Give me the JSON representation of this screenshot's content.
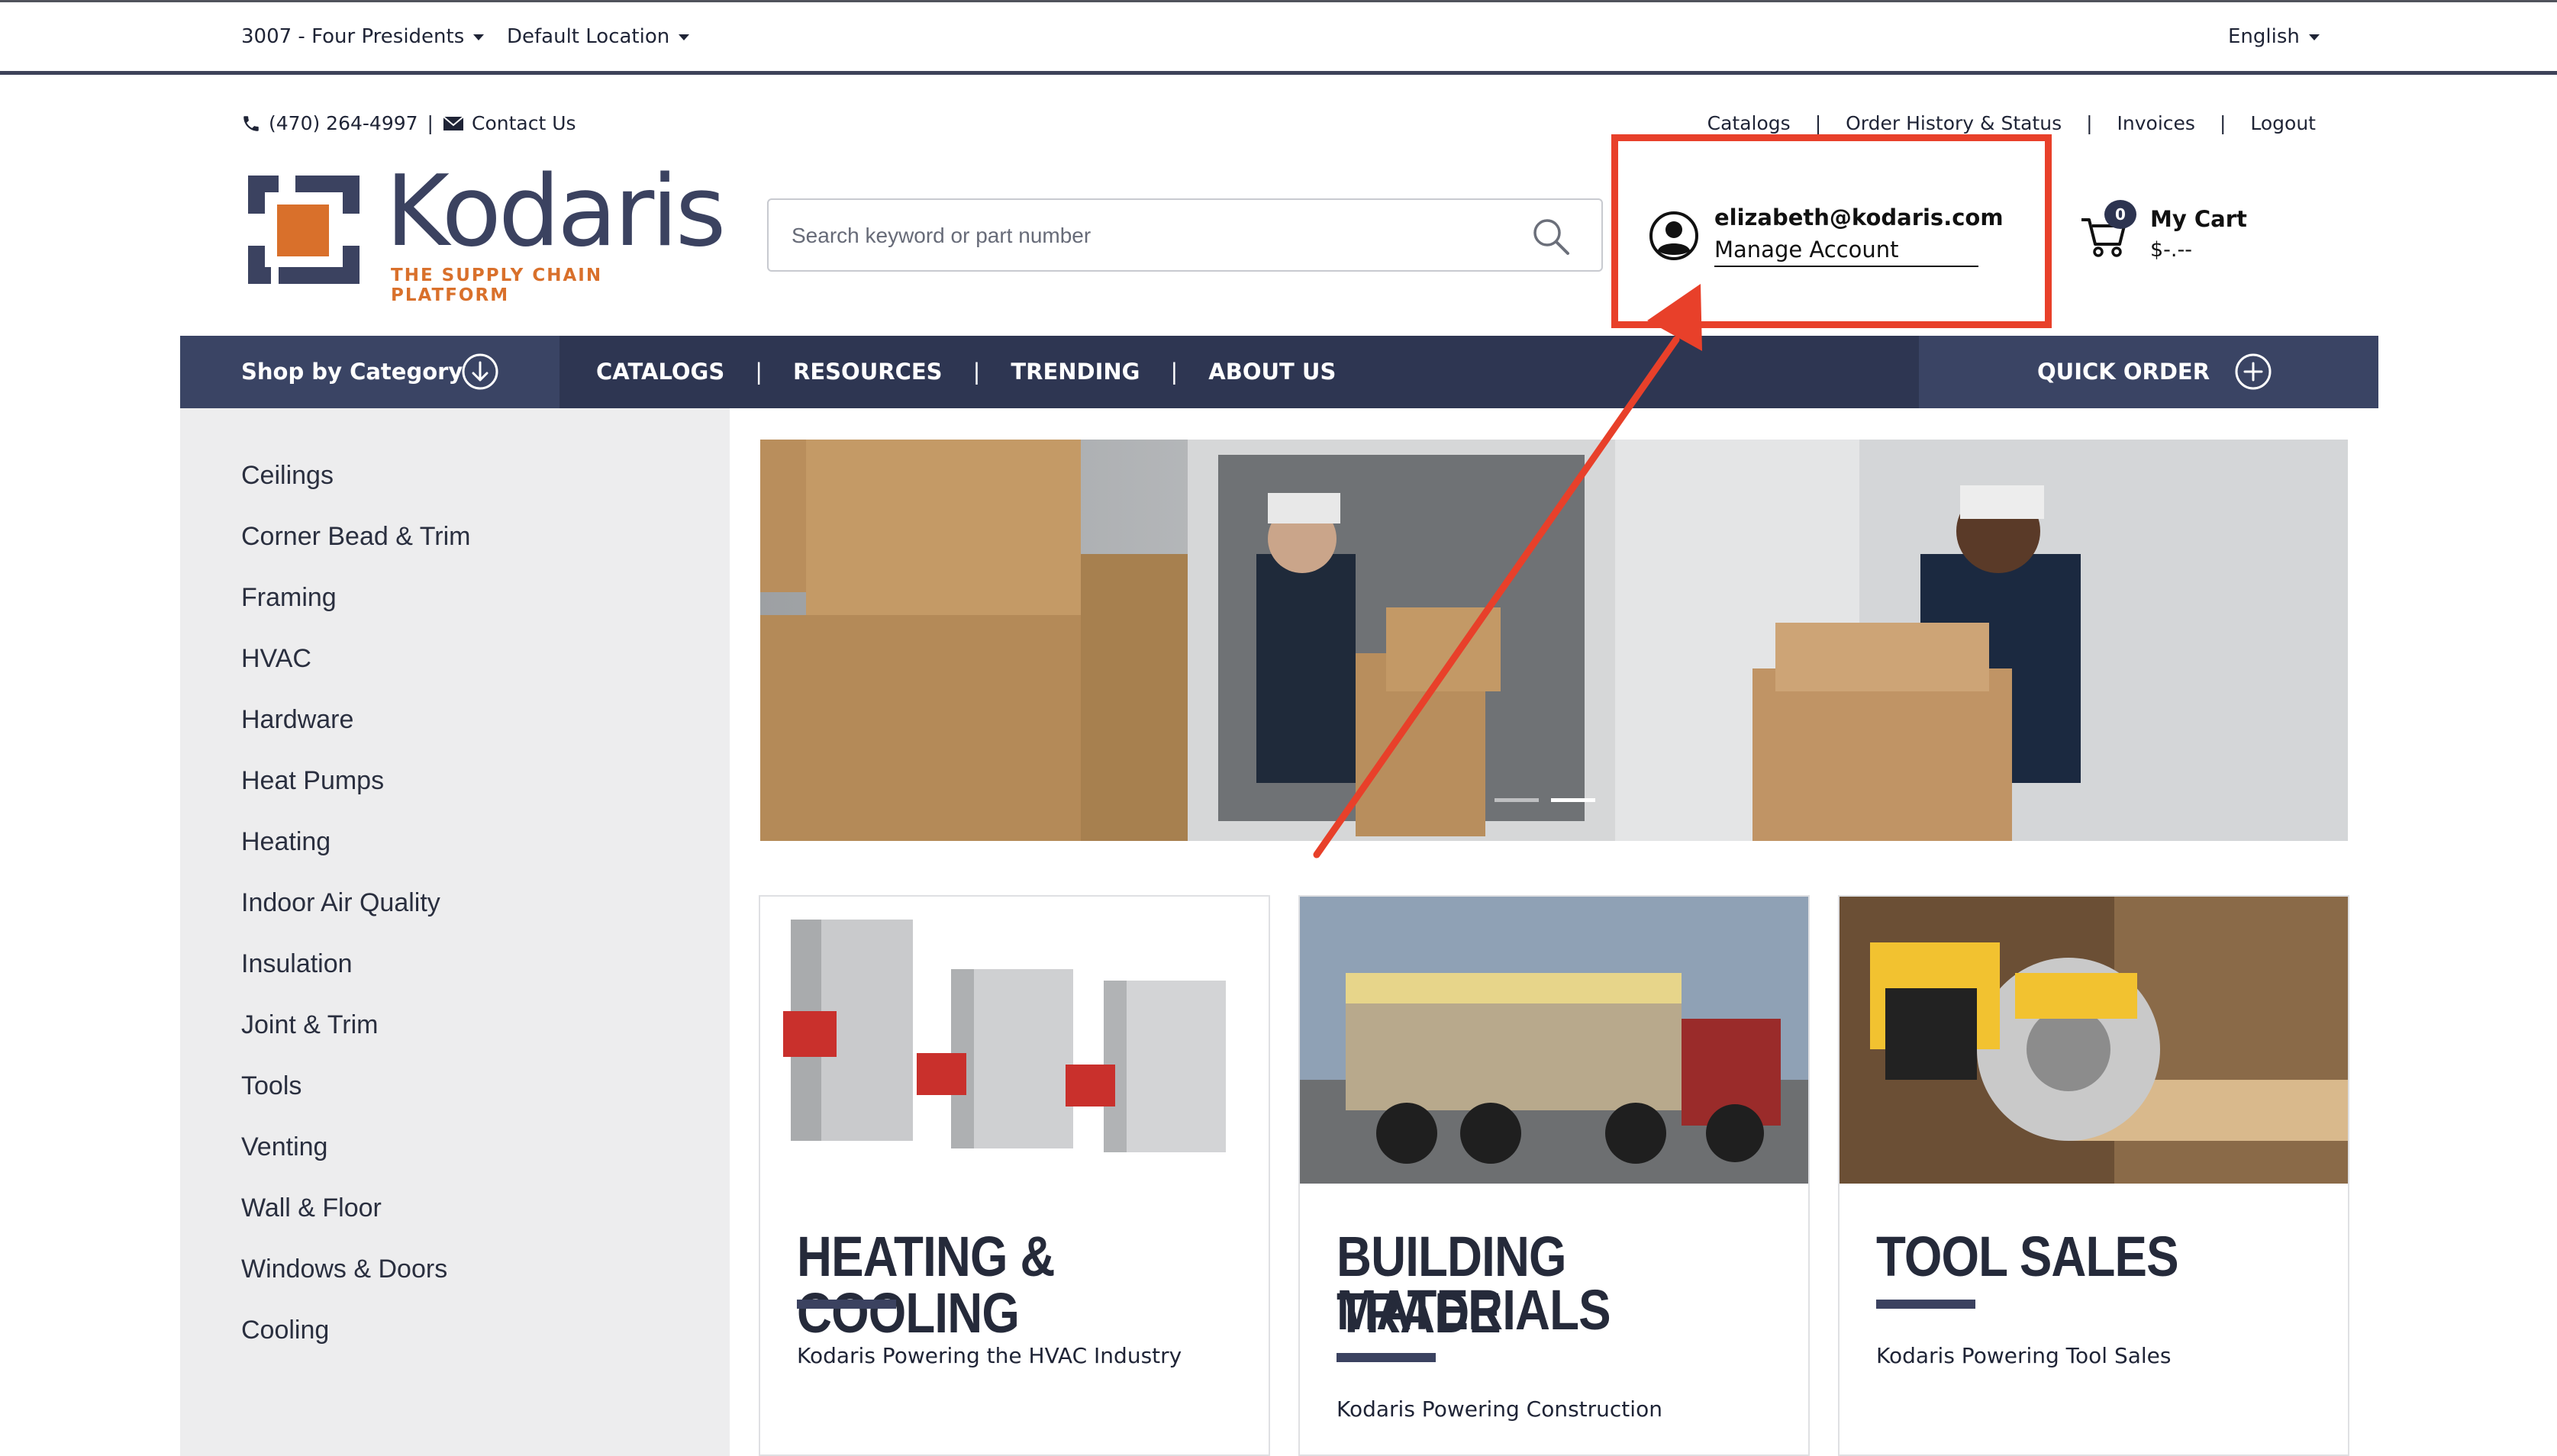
{
  "topbar": {
    "store": "3007 - Four Presidents",
    "location": "Default Location",
    "language": "English"
  },
  "header": {
    "phone": "(470) 264-4997",
    "contact": "Contact Us",
    "links": [
      "Catalogs",
      "Order History & Status",
      "Invoices",
      "Logout"
    ],
    "logo_text": "Kodaris",
    "logo_tagline": "THE SUPPLY CHAIN PLATFORM",
    "search_placeholder": "Search keyword or part number",
    "account_email": "elizabeth@kodaris.com",
    "manage_account": "Manage Account",
    "cart_count": "0",
    "cart_label": "My Cart",
    "cart_total": "$-.--"
  },
  "nav": {
    "shop_by_category": "Shop by Category",
    "items": [
      "CATALOGS",
      "RESOURCES",
      "TRENDING",
      "ABOUT US"
    ],
    "quick_order": "QUICK ORDER"
  },
  "sidebar": {
    "categories": [
      "Ceilings",
      "Corner Bead & Trim",
      "Framing",
      "HVAC",
      "Hardware",
      "Heat Pumps",
      "Heating",
      "Indoor Air Quality",
      "Insulation",
      "Joint & Trim",
      "Tools",
      "Venting",
      "Wall & Floor",
      "Windows & Doors",
      "Cooling"
    ]
  },
  "cards": [
    {
      "title": "HEATING & COOLING",
      "subtitle": "Kodaris Powering the HVAC Industry"
    },
    {
      "title_line1": "BUILDING TRADE",
      "title_line2": "MATERIALS",
      "subtitle": "Kodaris Powering Construction"
    },
    {
      "title": "TOOL SALES",
      "subtitle": "Kodaris Powering Tool Sales"
    }
  ],
  "colors": {
    "navy": "#2e3652",
    "logo_navy": "#3b4260",
    "logo_orange": "#d9702b",
    "annotation_red": "#e8402a",
    "sidebar_bg": "#ededee"
  }
}
